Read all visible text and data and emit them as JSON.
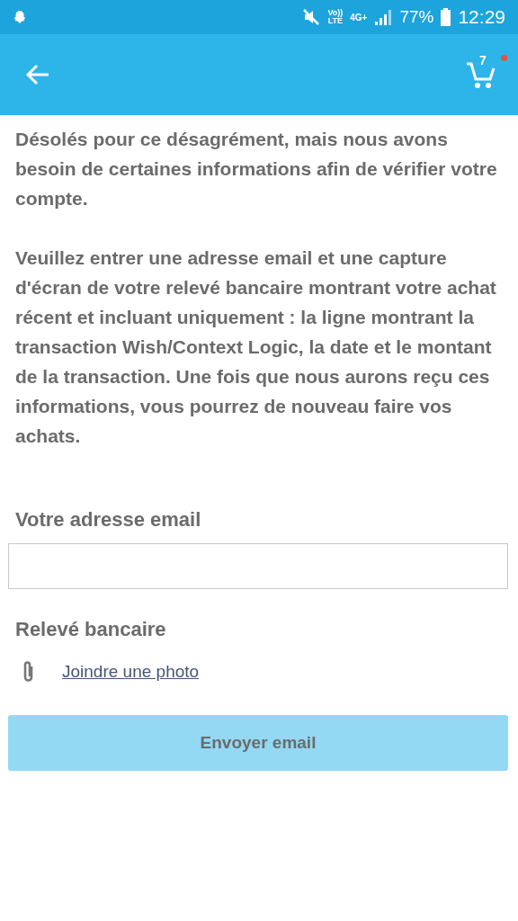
{
  "status_bar": {
    "volte": [
      "Vo))",
      "LTE"
    ],
    "network": "4G+",
    "battery": "77%",
    "time": "12:29"
  },
  "toolbar": {
    "cart_count": "7",
    "cart_notification": true
  },
  "paragraphs": [
    "Désolés pour ce désagrément, mais nous avons besoin de certaines informations afin de vérifier votre compte.",
    "Veuillez entrer une adresse email et une capture d'écran de votre relevé bancaire montrant votre achat récent et incluant uniquement : la ligne montrant la transaction Wish/Context Logic, la date et le montant de la transaction. Une fois que nous aurons reçu ces informations, vous pourrez de nouveau faire vos achats."
  ],
  "email": {
    "label": "Votre adresse email"
  },
  "statement": {
    "label": "Relevé bancaire",
    "link": "Joindre une photo"
  },
  "submit": {
    "label": "Envoyer email",
    "disabled": true
  }
}
